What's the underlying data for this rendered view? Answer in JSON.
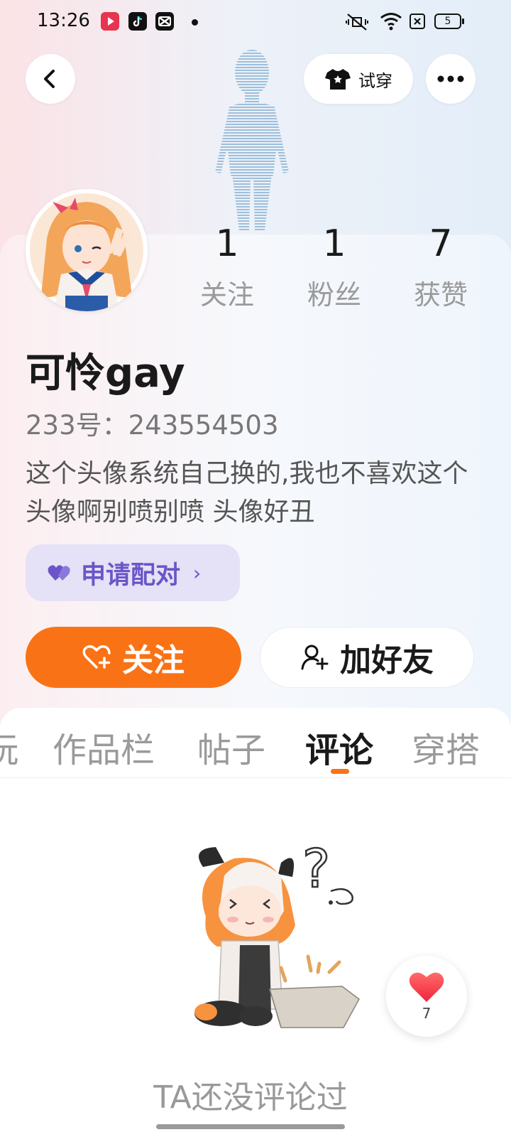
{
  "statusbar": {
    "time": "13:26",
    "battery": "5",
    "app_icons": [
      "video-app-icon",
      "tiktok-icon",
      "capcut-icon"
    ]
  },
  "header": {
    "tryon_label": "试穿"
  },
  "profile": {
    "name": "可怜gay",
    "id_text": "233号：243554503",
    "bio": "这个头像系统自己换的,我也不喜欢这个头像啊别喷别喷 头像好丑",
    "stats": [
      {
        "num": "1",
        "label": "关注"
      },
      {
        "num": "1",
        "label": "粉丝"
      },
      {
        "num": "7",
        "label": "获赞"
      }
    ]
  },
  "actions": {
    "pair_label": "申请配对",
    "pair_chevron": "›",
    "follow_label": "关注",
    "add_friend_label": "加好友"
  },
  "tabs": [
    {
      "label": "玩"
    },
    {
      "label": "作品栏"
    },
    {
      "label": "帖子"
    },
    {
      "label": "评论",
      "active": true
    },
    {
      "label": "穿搭"
    }
  ],
  "empty": {
    "text": "TA还没评论过"
  },
  "like_fab": {
    "count": "7"
  },
  "colors": {
    "accent_orange": "#f97316",
    "pair_purple": "#6b55c8",
    "pair_bg": "#e5e1f6"
  }
}
